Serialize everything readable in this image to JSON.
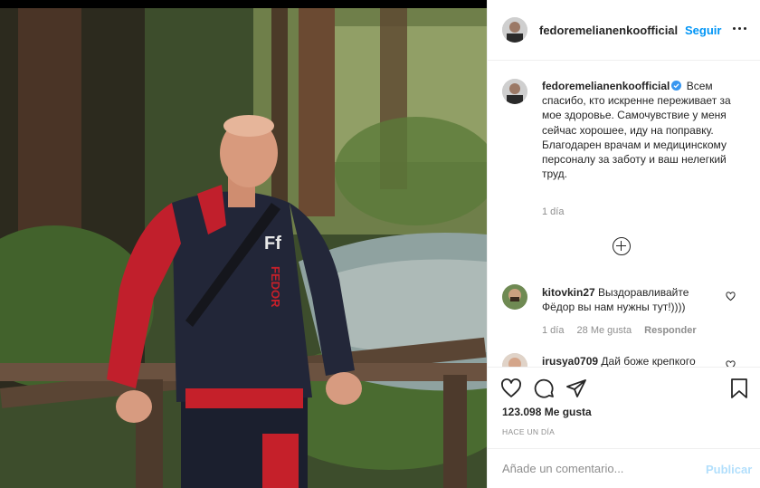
{
  "post": {
    "author": "fedoremelianenkoofficial",
    "header_separator": "•",
    "follow_label": "Seguir",
    "more_icon": "more-horizontal-icon",
    "caption": {
      "username": "fedoremelianenkoofficial",
      "text": "Всем спасибо, кто искренне переживает за мое здоровье. Самочувствие у меня сейчас хорошее, иду на поправку. Благодарен врачам и медицинскому персоналу за заботу и ваш нелегкий труд.",
      "time": "1 día"
    },
    "comments": [
      {
        "username": "kitovkin27",
        "text": "Выздоравливайте Фёдор вы нам нужны тут!))))",
        "time": "1 día",
        "likes": "28 Me gusta",
        "reply_label": "Responder"
      },
      {
        "username": "irusya0709",
        "text": "Дай боже крепкого"
      }
    ],
    "likes_count": "123.098 Me gusta",
    "date": "HACE UN DÍA",
    "add_comment_placeholder": "Añade un comentario...",
    "publish_label": "Publicar",
    "colors": {
      "link_blue": "#0095f6",
      "publish_disabled": "#b2dffc",
      "muted_gray": "#8e8e8e",
      "text_dark": "#262626",
      "verified_blue": "#3897f0"
    },
    "photo": {
      "shirt_logo": "Ff",
      "shirt_text": "FEDOR EMELIANENKO"
    }
  }
}
